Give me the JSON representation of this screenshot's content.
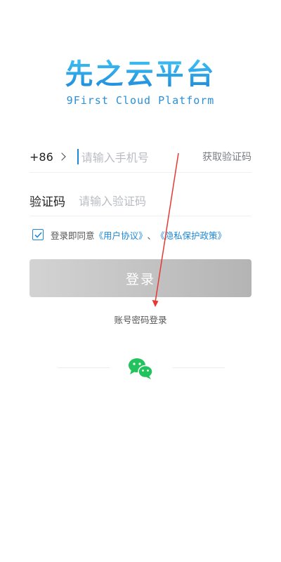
{
  "logo": {
    "title": "先之云平台",
    "subtitle": "9First Cloud Platform"
  },
  "phone_row": {
    "country_code": "+86",
    "placeholder": "请输入手机号",
    "get_code": "获取验证码"
  },
  "code_row": {
    "label": "验证码",
    "placeholder": "请输入验证码"
  },
  "agreement": {
    "checked": true,
    "prefix": "登录即同意",
    "user_agreement": "《用户协议》",
    "separator": "、",
    "privacy_policy": "《隐私保护政策》"
  },
  "login_button": {
    "label": "登录"
  },
  "password_login": {
    "label": "账号密码登录"
  },
  "colors": {
    "accent": "#1e88d8",
    "wechat_green": "#22c35d",
    "annotation_red": "#e53935"
  },
  "icons": {
    "country_selector": "chevron-right-icon",
    "agreement_checkbox": "checkmark-icon",
    "third_party_login": "wechat-icon"
  }
}
